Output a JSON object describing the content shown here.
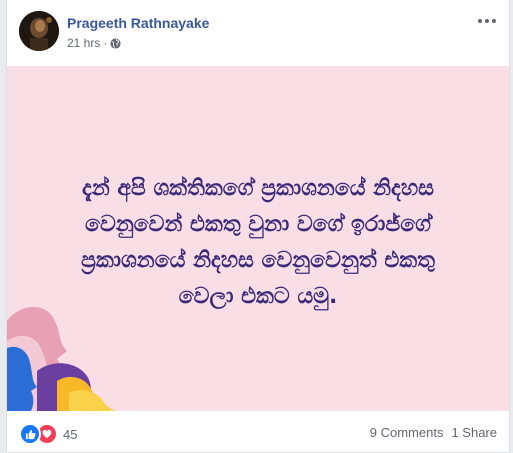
{
  "post": {
    "author": "Prageeth Rathnayake",
    "time": "21 hrs",
    "separator": "·",
    "privacy_icon": "globe-icon",
    "more_icon": "more-options-icon",
    "image_text_lines": [
      "දැන් අපි ශක්තිකගේ ප්‍රකාශනයේ නිදහස",
      "වෙනුවෙන් එකතු වුනා වගේ ඉරාජ්ගේ",
      "ප්‍රකාශනයේ නිදහස වෙනුවෙනුත් එකතු",
      "වෙලා එකට යමු."
    ],
    "image_background": "#f9dee6",
    "image_text_color": "#3a2a78"
  },
  "footer": {
    "reaction_icons": [
      "like-icon",
      "love-icon"
    ],
    "reaction_count": "45",
    "comments": "9 Comments",
    "shares": "1 Share"
  },
  "colors": {
    "author_link": "#385898",
    "like": "#1877f2",
    "love": "#f33e58",
    "secondary_text": "#606770"
  }
}
